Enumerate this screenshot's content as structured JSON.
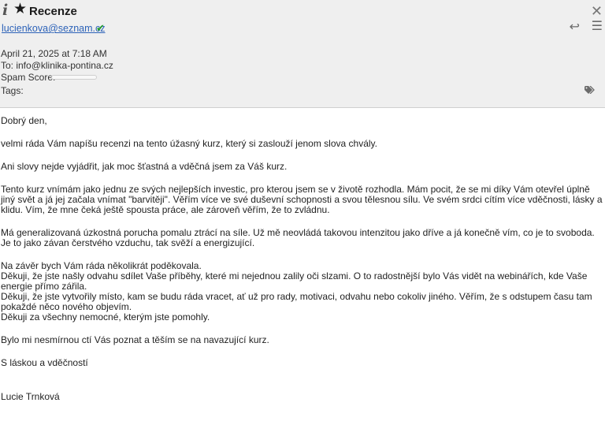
{
  "header": {
    "subject": "Recenze",
    "sender": "lucienkova@seznam.cz",
    "date": "April 21, 2025 at 7:18 AM",
    "to": "To: info@klinika-pontina.cz",
    "spam_label": "Spam Score:",
    "tags_label": "Tags:"
  },
  "icons": {
    "info": "i",
    "star": "★",
    "close": "✕",
    "check": "✔",
    "reply": "↩",
    "menu": "☰"
  },
  "body": {
    "paragraphs": [
      "Dobrý den,",
      "velmi ráda Vám napíšu recenzi na tento úžasný kurz, který si zaslouží jenom slova chvály.",
      "Ani slovy nejde vyjádřit, jak moc šťastná a vděčná jsem za Váš kurz.",
      "Tento kurz vnímám jako jednu ze svých nejlepších investic, pro kterou jsem se v životě rozhodla. Mám pocit, že se mi díky Vám otevřel úplně jiný svět a já jej začala vnímat \"barvitěji\". Věřím více ve své duševní schopnosti a svou tělesnou sílu. Ve svém srdci cítím více vděčnosti, lásky a klidu. Vím, že mne čeká ještě spousta práce, ale zároveň věřím, že to zvládnu.",
      "Má generalizovaná úzkostná porucha pomalu ztrácí na síle. Už mě neovládá takovou intenzitou jako dříve a já konečně vím, co je to svoboda. Je to jako závan čerstvého vzduchu, tak svěží a energizující.",
      "Na závěr bych Vám ráda několikrát poděkovala.\nDěkuji, že jste našly odvahu sdílet Vaše příběhy, které mi nejednou zalily oči slzami. O to radostnější bylo Vás vidět na webinářích, kde Vaše energie přímo zářila.\nDěkuji, že jste vytvořily místo, kam se budu ráda vracet, ať už pro rady, motivaci, odvahu nebo cokoliv jiného. Věřím, že s odstupem času tam pokaždé něco nového objevím.\nDěkuji za všechny nemocné, kterým jste pomohly.",
      "Bylo mi nesmírnou ctí Vás poznat a těším se na navazující kurz.",
      "S láskou a vděčností",
      "Lucie Trnková"
    ]
  }
}
